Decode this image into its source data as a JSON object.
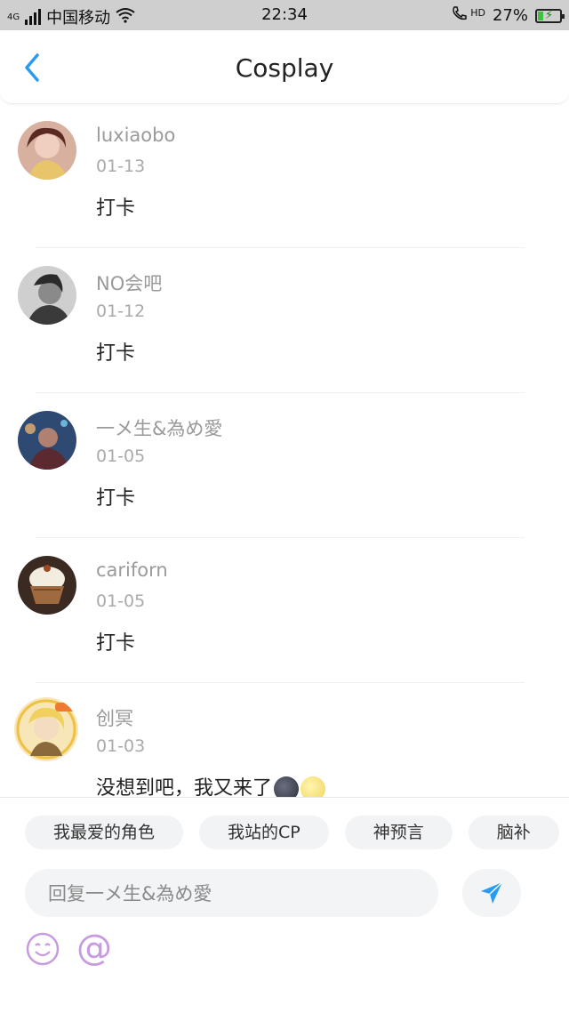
{
  "status_bar": {
    "carrier": "中国移动",
    "network": "4G",
    "time": "22:34",
    "hd": "HD",
    "battery": "27%",
    "battery_level": 0.27
  },
  "nav": {
    "title": "Cosplay",
    "back_icon": "chevron-left-icon"
  },
  "comments": [
    {
      "name": "luxiaobo",
      "date": "01-13",
      "text": "打卡",
      "avatar_color": "#c07a66"
    },
    {
      "name": "NO会吧",
      "date": "01-12",
      "text": "打卡",
      "avatar_color": "#555555"
    },
    {
      "name": "一メ生&為め愛",
      "date": "01-05",
      "text": "打卡",
      "avatar_color": "#2e4a72"
    },
    {
      "name": "cariforn",
      "date": "01-05",
      "text": "打卡",
      "avatar_color": "#8a5a3a"
    },
    {
      "name": "创冥",
      "date": "01-03",
      "text": "没想到吧，我又来了",
      "emojis": [
        "new-moon-face",
        "full-moon-face"
      ],
      "avatar_color": "#f2c650"
    }
  ],
  "bottom": {
    "chips": [
      "我最爱的角色",
      "我站的CP",
      "神预言",
      "脑补"
    ],
    "reply_placeholder": "回复一メ生&為め愛",
    "send_icon": "send-icon",
    "emoji_icon": "smiley-icon",
    "at_label": "@"
  },
  "colors": {
    "accent": "#2a9cf0",
    "emoji_purple": "#c79be0",
    "status_bar": "#cfcfcf"
  }
}
